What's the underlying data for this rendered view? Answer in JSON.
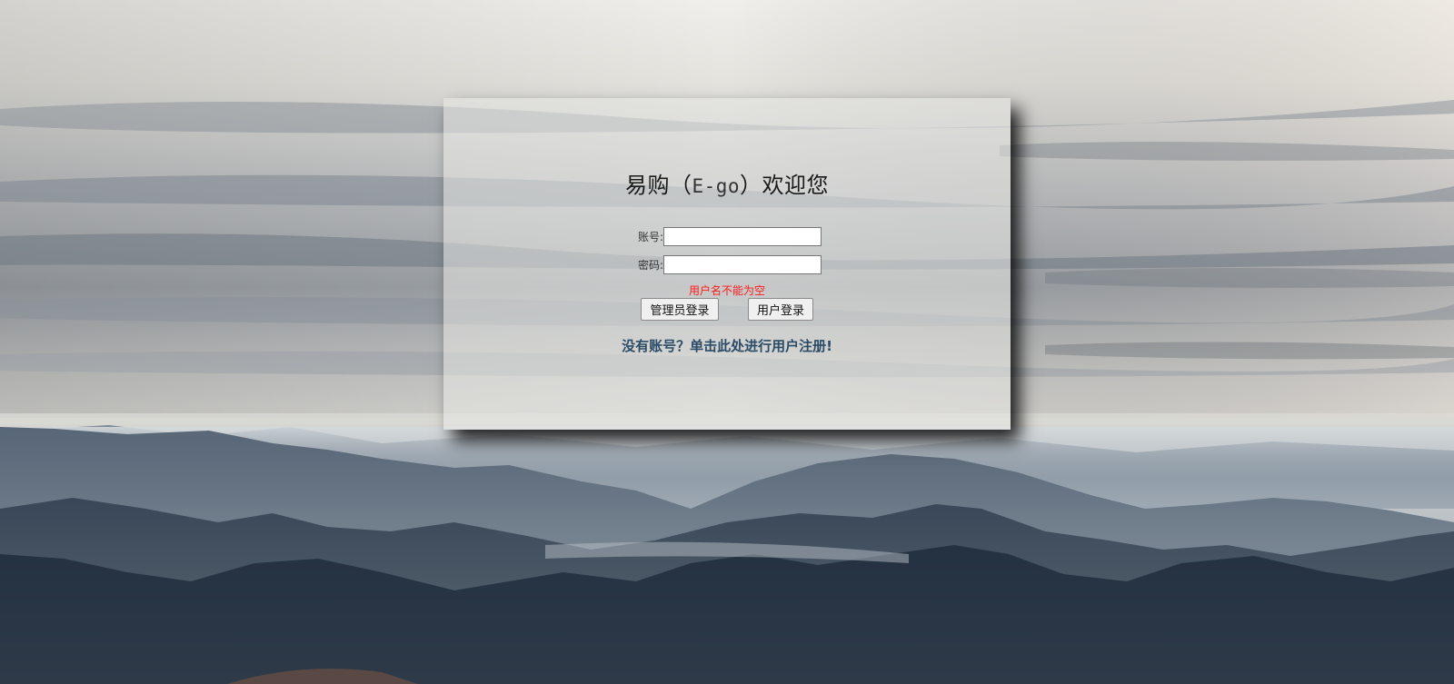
{
  "login": {
    "title_prefix": "易购（",
    "title_latin": "E-go",
    "title_suffix": "）欢迎您",
    "account_label": "账号:",
    "account_value": "",
    "password_label": "密码:",
    "password_value": "",
    "error_message": "用户名不能为空",
    "admin_login_button": "管理员登录",
    "user_login_button": "用户登录",
    "register_link": "没有账号？单击此处进行用户注册!"
  },
  "colors": {
    "error": "#ff1a1a",
    "link": "#2b4b66",
    "sky_top": "#f0efeb",
    "mountain_dark": "#2b3848"
  }
}
